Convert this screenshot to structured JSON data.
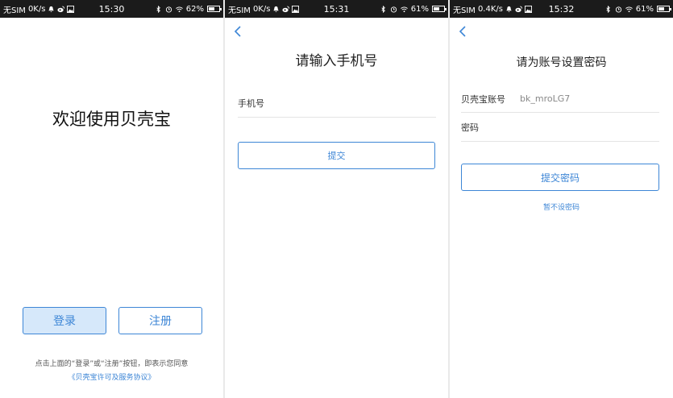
{
  "colors": {
    "accent": "#3d86d6",
    "login_bg": "#d6e8fa",
    "statusbar": "#1b1b1b"
  },
  "screens": [
    {
      "status": {
        "carrier": "无SIM",
        "speed": "0K/s",
        "time": "15:30",
        "battery": "62%",
        "battery_level": 0.62
      },
      "welcome_title": "欢迎使用贝壳宝",
      "login_label": "登录",
      "register_label": "注册",
      "agreement_text": "点击上面的“登录”或“注册”按钮，即表示您同意",
      "agreement_link": "《贝壳宝许可及服务协议》"
    },
    {
      "status": {
        "carrier": "无SIM",
        "speed": "0K/s",
        "time": "15:31",
        "battery": "61%",
        "battery_level": 0.61
      },
      "back_icon": "chevron-left-icon",
      "title": "请输入手机号",
      "phone_placeholder": "手机号",
      "submit_label": "提交"
    },
    {
      "status": {
        "carrier": "无SIM",
        "speed": "0.4K/s",
        "time": "15:32",
        "battery": "61%",
        "battery_level": 0.61
      },
      "back_icon": "chevron-left-icon",
      "title": "请为账号设置密码",
      "account_label": "贝壳宝账号",
      "account_value": "bk_mroLG7",
      "password_label": "密码",
      "submit_label": "提交密码",
      "skip_label": "暂不设密码"
    }
  ]
}
